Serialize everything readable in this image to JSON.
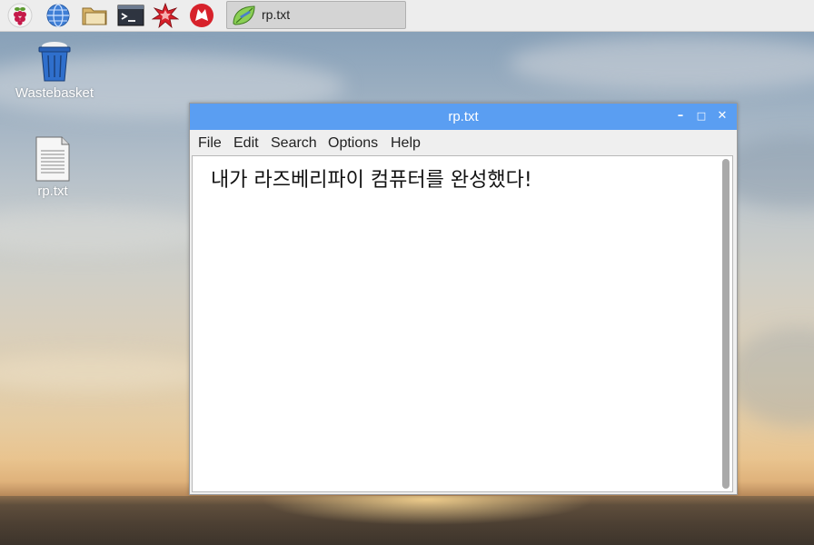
{
  "taskbar": {
    "launchers": [
      {
        "icon": "raspberry-menu-icon"
      },
      {
        "icon": "web-browser-icon"
      },
      {
        "icon": "file-manager-icon"
      },
      {
        "icon": "terminal-icon"
      },
      {
        "icon": "mathematica-icon"
      },
      {
        "icon": "wolfram-icon"
      }
    ],
    "task": {
      "label": "rp.txt",
      "icon": "text-editor-icon"
    }
  },
  "desktop": {
    "icons": [
      {
        "label": "Wastebasket",
        "icon": "trash-icon"
      },
      {
        "label": "rp.txt",
        "icon": "text-file-icon"
      }
    ]
  },
  "window": {
    "title": "rp.txt",
    "controls": {
      "minimize": "–",
      "maximize": "□",
      "close": "✕"
    },
    "menu": [
      "File",
      "Edit",
      "Search",
      "Options",
      "Help"
    ],
    "content": "내가 라즈베리파이 컴퓨터를 완성했다!"
  },
  "colors": {
    "titlebar": "#5a9ef2",
    "panel": "#ededed",
    "accent_red": "#c51a4a"
  }
}
